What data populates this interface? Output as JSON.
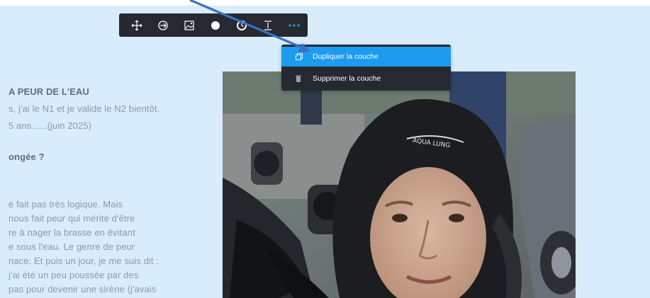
{
  "toolbar": {
    "buttons": [
      {
        "name": "move-icon"
      },
      {
        "name": "rotate-icon"
      },
      {
        "name": "image-icon"
      },
      {
        "name": "circle-icon"
      },
      {
        "name": "clock-icon"
      },
      {
        "name": "align-icon"
      },
      {
        "name": "more-icon"
      }
    ]
  },
  "menu": {
    "items": [
      {
        "label": "Dupliquer la couche",
        "icon": "duplicate-icon",
        "active": true
      },
      {
        "label": "Supprimer la couche",
        "icon": "trash-icon",
        "active": false
      }
    ]
  },
  "article": {
    "lines": [
      {
        "text": "A PEUR DE L'EAU",
        "heading": true
      },
      {
        "text": "s, j'ai le N1 et je valide le N2 bientôt.",
        "heading": false
      },
      {
        "text": " 5 ans......(juin 2025)",
        "heading": false
      },
      {
        "text": "ongée ?",
        "heading": true
      },
      {
        "text": "e fait pas très logique. Mais",
        "heading": false
      },
      {
        "text": "nous fait peur qui mérite d'être",
        "heading": false
      },
      {
        "text": "re à nager la brasse en évitant",
        "heading": false
      },
      {
        "text": "e sous l'eau. Le genre de peur",
        "heading": false
      },
      {
        "text": "nace. Et puis un jour, je me suis dit :",
        "heading": false
      },
      {
        "text": " j'ai été un peu poussée par des",
        "heading": false
      },
      {
        "text": "pas pour devenir une sirène (j'avais",
        "heading": false
      }
    ]
  },
  "photo": {
    "hood_brand": "AQUA LUNG"
  },
  "colors": {
    "background": "#d8ecfb",
    "toolbar_bg": "#262a30",
    "accent": "#1d9bf0",
    "arrow": "#3b6fc4"
  }
}
